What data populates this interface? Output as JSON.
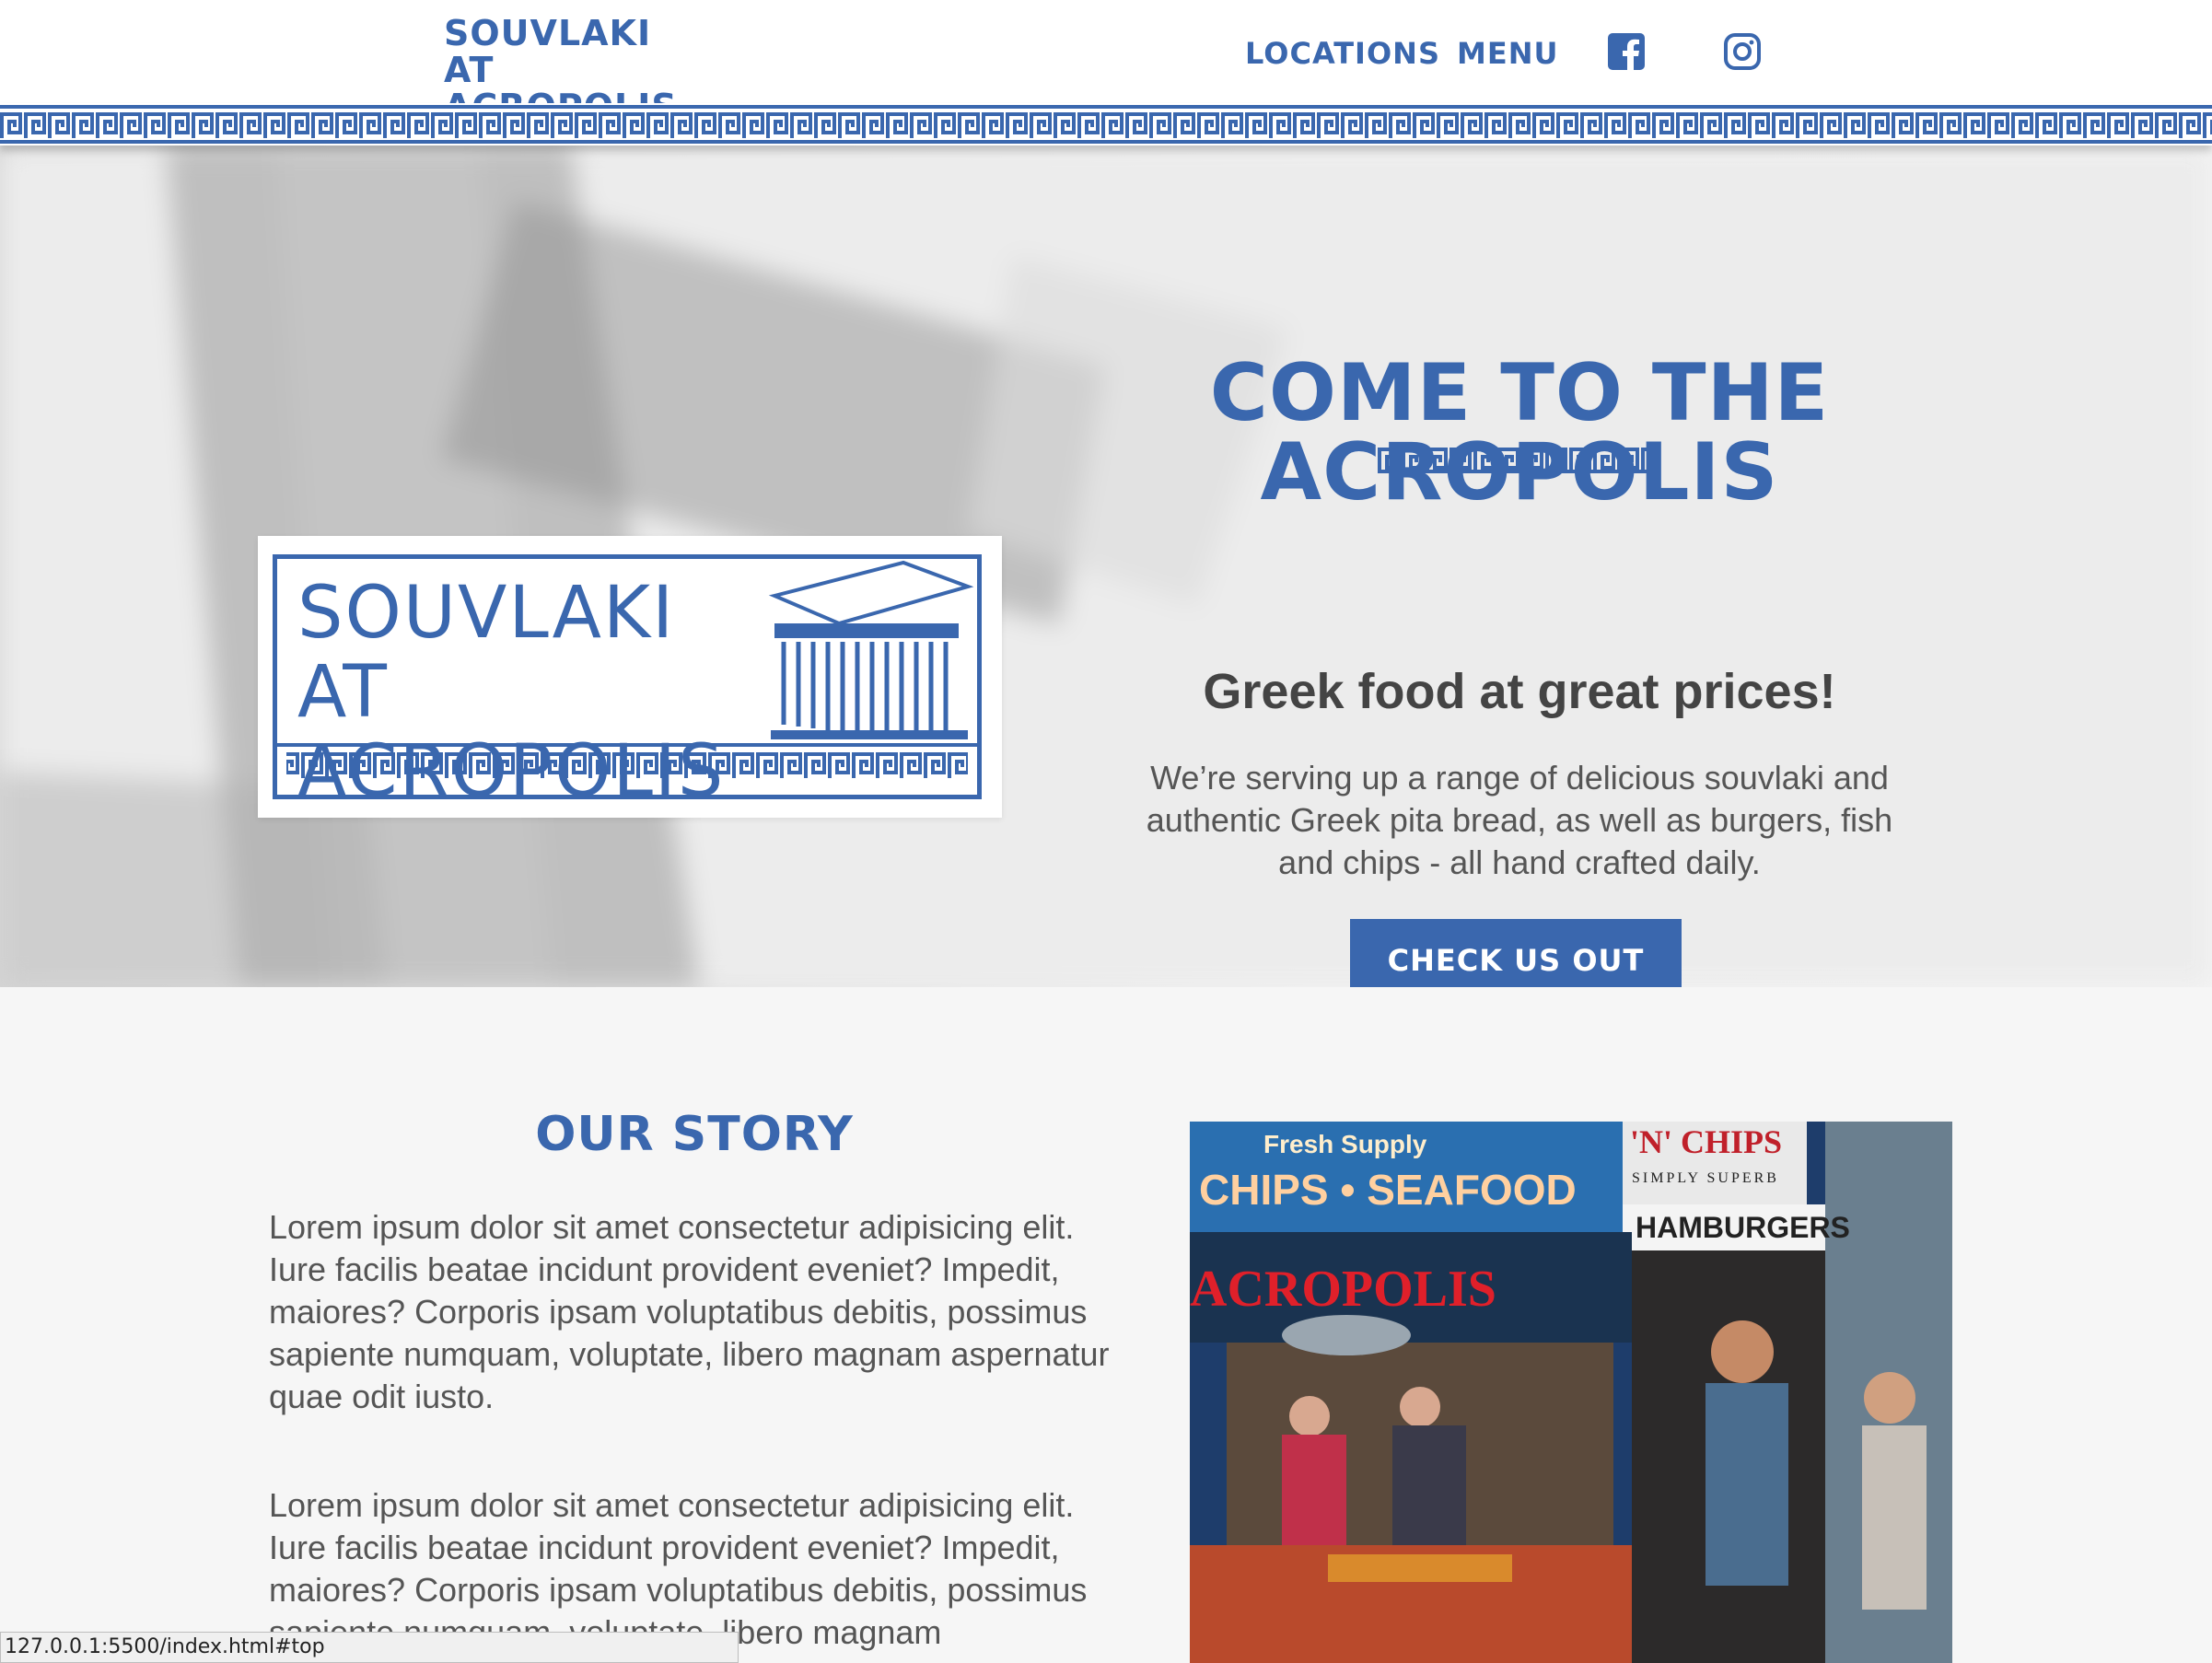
{
  "header": {
    "brand": "SOUVLAKI AT ACROPOLIS",
    "nav": {
      "locations": "Locations",
      "menu": "Menu"
    },
    "social": {
      "facebook_icon": "facebook-icon",
      "instagram_icon": "instagram-icon"
    }
  },
  "hero": {
    "title": "Come to the Acropolis",
    "subtitle": "Greek food at great prices!",
    "description": "We’re serving up a range of delicious souvlaki and authentic Greek pita bread, as well as burgers, fish and chips - all hand crafted daily.",
    "cta": "Check us out",
    "logo_text": "SOUVLAKI AT ACROPOLIS"
  },
  "story": {
    "title": "Our Story",
    "paragraphs": [
      "Lorem ipsum dolor sit amet consectetur adipisicing elit. Iure facilis beatae incidunt provident eveniet? Impedit, maiores? Corporis ipsam voluptatibus debitis, possimus sapiente numquam, voluptate, libero magnam aspernatur quae odit iusto.",
      "Lorem ipsum dolor sit amet consectetur adipisicing elit. Iure facilis beatae incidunt provident eveniet? Impedit, maiores? Corporis ipsam voluptatibus debitis, possimus sapiente numquam, voluptate, libero magnam"
    ],
    "photo_signs": {
      "sign1": "CHIPS • SEAFOOD",
      "sign2": "'N' CHIPS",
      "sign3": "SIMPLY SUPERB",
      "sign4": "HAMBURGERS",
      "sign5": "ACROPOLIS",
      "sign6": "Fresh Supply"
    }
  },
  "status_bar": "127.0.0.1:5500/index.html#top",
  "colors": {
    "brand_blue": "#3a67ae",
    "text_gray": "#555555"
  }
}
